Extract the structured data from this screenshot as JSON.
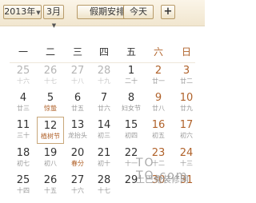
{
  "toolbar": {
    "year_value": "2013年",
    "month_value": "3月",
    "holiday_label": "假期安排",
    "today_label": "今天",
    "add_label": "+"
  },
  "weekdays": [
    "一",
    "二",
    "三",
    "四",
    "五",
    "六",
    "日"
  ],
  "weeks": [
    [
      {
        "day": "25",
        "lunar": "十六",
        "dim": true
      },
      {
        "day": "26",
        "lunar": "十七",
        "dim": true
      },
      {
        "day": "27",
        "lunar": "十八",
        "dim": true
      },
      {
        "day": "28",
        "lunar": "十九",
        "dim": true
      },
      {
        "day": "1",
        "lunar": "二十"
      },
      {
        "day": "2",
        "lunar": "廿一",
        "we": true
      },
      {
        "day": "3",
        "lunar": "廿二",
        "we": true
      }
    ],
    [
      {
        "day": "4",
        "lunar": "廿三"
      },
      {
        "day": "5",
        "lunar": "惊蛰",
        "festival": true
      },
      {
        "day": "6",
        "lunar": "廿五"
      },
      {
        "day": "7",
        "lunar": "廿六"
      },
      {
        "day": "8",
        "lunar": "妇女节"
      },
      {
        "day": "9",
        "lunar": "廿八",
        "we": true
      },
      {
        "day": "10",
        "lunar": "廿九",
        "we": true
      }
    ],
    [
      {
        "day": "11",
        "lunar": "三十"
      },
      {
        "day": "12",
        "lunar": "植树节",
        "sel": true,
        "festival": true
      },
      {
        "day": "13",
        "lunar": "龙抬头"
      },
      {
        "day": "14",
        "lunar": "初三"
      },
      {
        "day": "15",
        "lunar": "初四"
      },
      {
        "day": "16",
        "lunar": "初五",
        "we": true
      },
      {
        "day": "17",
        "lunar": "初六",
        "we": true
      }
    ],
    [
      {
        "day": "18",
        "lunar": "初七"
      },
      {
        "day": "19",
        "lunar": "初八"
      },
      {
        "day": "20",
        "lunar": "春分",
        "festival": true
      },
      {
        "day": "21",
        "lunar": "初十"
      },
      {
        "day": "22",
        "lunar": "十一"
      },
      {
        "day": "23",
        "lunar": "十二",
        "we": true
      },
      {
        "day": "24",
        "lunar": "十三",
        "we": true
      }
    ],
    [
      {
        "day": "25",
        "lunar": "十四"
      },
      {
        "day": "26",
        "lunar": "十五"
      },
      {
        "day": "27",
        "lunar": "十六"
      },
      {
        "day": "28",
        "lunar": "十七"
      },
      {
        "day": "29",
        "lunar": ""
      },
      {
        "day": "30",
        "lunar": "",
        "we": true
      },
      {
        "day": "31",
        "lunar": "",
        "we": true
      }
    ]
  ],
  "watermark": {
    "logo": "TO TO.com",
    "text": "土巴兔装修网"
  }
}
